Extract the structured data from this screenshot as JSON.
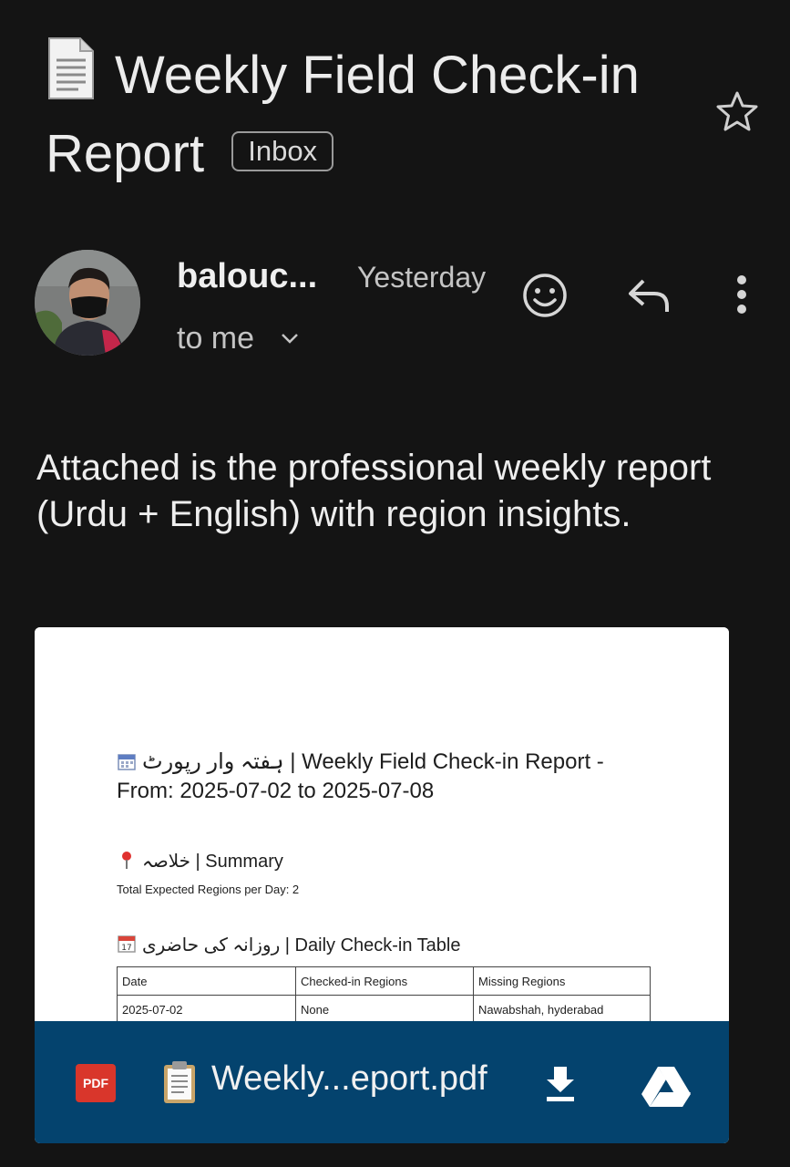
{
  "email": {
    "subject": "Weekly Field Check-in Report",
    "label": "Inbox",
    "sender": "balouc...",
    "time": "Yesterday",
    "recipient": "to me",
    "body": "Attached is the professional weekly report (Urdu + English) with region insights."
  },
  "attachment": {
    "preview": {
      "title_line1": "ہفتہ وار رپورٹ | Weekly Field Check-in Report -",
      "title_line2": "From: 2025-07-02 to 2025-07-08",
      "summary_heading": "خلاصہ | Summary",
      "expected": "Total Expected Regions per Day: 2",
      "table_heading": "روزانہ کی حاضری | Daily Check-in Table",
      "table_headers": [
        "Date",
        "Checked-in Regions",
        "Missing Regions"
      ],
      "table_rows": [
        [
          "2025-07-02",
          "None",
          "Nawabshah, hyderabad"
        ]
      ]
    },
    "badge": "PDF",
    "filename": "Weekly...eport.pdf"
  },
  "icons": [
    "document-icon",
    "star-icon",
    "smiley-icon",
    "reply-icon",
    "more-icon",
    "chevron-down-icon",
    "calendar-icon",
    "pin-icon",
    "clipboard-icon",
    "download-icon",
    "drive-icon"
  ],
  "colors": {
    "background": "#141414",
    "attachment_bar": "#04436e",
    "pdf_badge": "#d9362b"
  }
}
